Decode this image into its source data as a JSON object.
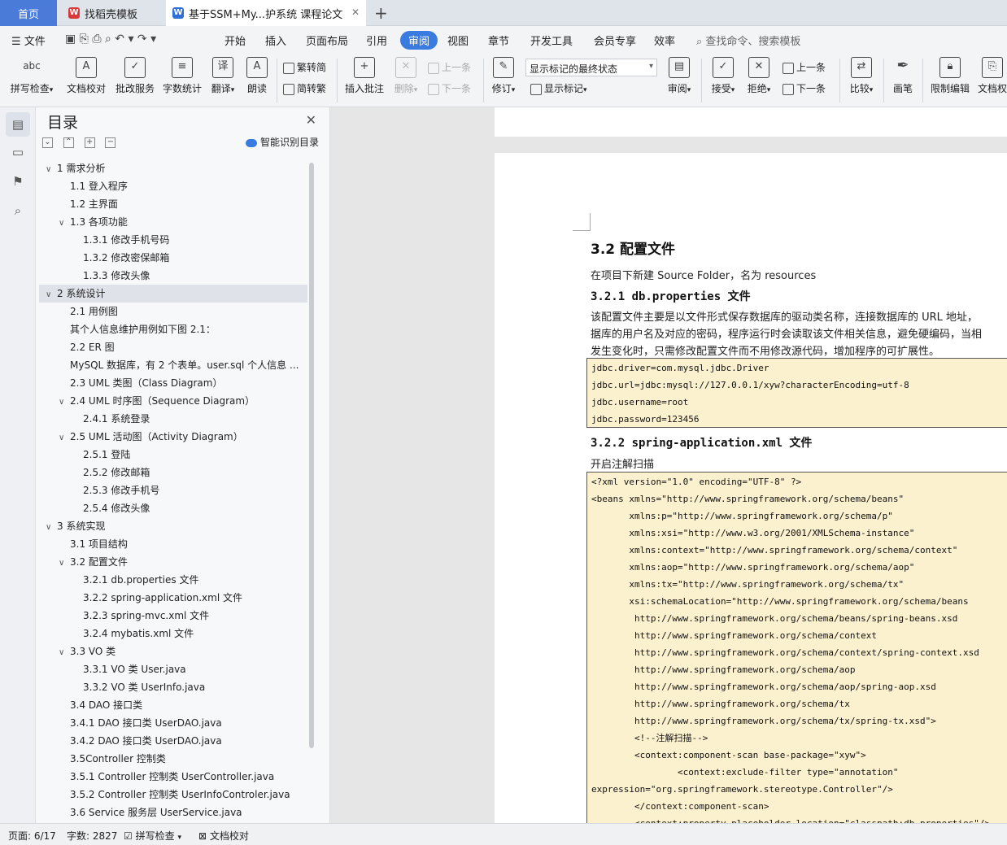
{
  "tabs": {
    "home": "首页",
    "pdf": "找稻壳模板",
    "doc": "基于SSM+My...护系统 课程论文"
  },
  "menu": {
    "file": "文件",
    "items": [
      "开始",
      "插入",
      "页面布局",
      "引用",
      "审阅",
      "视图",
      "章节",
      "开发工具",
      "会员专享",
      "效率"
    ],
    "active": "审阅",
    "search": "查找命令、搜索模板"
  },
  "ribbon": {
    "spellcheck": "拼写检查",
    "proofread": "文档校对",
    "correction": "批改服务",
    "wordcount": "字数统计",
    "translate": "翻译",
    "read": "朗读",
    "trad_to_simp": "繁转简",
    "simp_to_trad": "简转繁",
    "insert_comment": "插入批注",
    "delete": "删除",
    "prev": "上一条",
    "next": "下一条",
    "revise": "修订",
    "markup_dropdown": "显示标记的最终状态",
    "show_markup": "显示标记",
    "review": "审阅",
    "accept": "接受",
    "reject": "拒绝",
    "prev2": "上一条",
    "next2": "下一条",
    "compare": "比较",
    "pen": "画笔",
    "restrict": "限制编辑",
    "doc_rights": "文档权"
  },
  "toc": {
    "title": "目录",
    "smart": "智能识别目录",
    "items": [
      {
        "arrow": "∨",
        "text": "1  需求分析",
        "level": 0
      },
      {
        "arrow": "",
        "text": "1.1 登入程序",
        "level": 1
      },
      {
        "arrow": "",
        "text": "1.2 主界面",
        "level": 1
      },
      {
        "arrow": "∨",
        "text": "1.3 各项功能",
        "level": 1
      },
      {
        "arrow": "",
        "text": "1.3.1  修改手机号码",
        "level": 2
      },
      {
        "arrow": "",
        "text": "1.3.2  修改密保邮箱",
        "level": 2
      },
      {
        "arrow": "",
        "text": "1.3.3  修改头像",
        "level": 2
      },
      {
        "arrow": "∨",
        "text": "2  系统设计",
        "level": 0,
        "selected": true
      },
      {
        "arrow": "",
        "text": "2.1 用例图",
        "level": 1
      },
      {
        "arrow": "",
        "text": "其个人信息维护用例如下图 2.1：",
        "level": 1
      },
      {
        "arrow": "",
        "text": "2.2 ER 图",
        "level": 1
      },
      {
        "arrow": "",
        "text": "MySQL 数据库，有 2 个表单。user.sql 个人信息 ...",
        "level": 1
      },
      {
        "arrow": "",
        "text": "2.3 UML 类图（Class Diagram）",
        "level": 1
      },
      {
        "arrow": "∨",
        "text": "2.4 UML 时序图（Sequence Diagram）",
        "level": 1
      },
      {
        "arrow": "",
        "text": "2.4.1  系统登录",
        "level": 2
      },
      {
        "arrow": "∨",
        "text": "2.5 UML 活动图（Activity Diagram）",
        "level": 1
      },
      {
        "arrow": "",
        "text": "2.5.1  登陆",
        "level": 2
      },
      {
        "arrow": "",
        "text": "2.5.2  修改邮箱",
        "level": 2
      },
      {
        "arrow": "",
        "text": "2.5.3  修改手机号",
        "level": 2
      },
      {
        "arrow": "",
        "text": "2.5.4  修改头像",
        "level": 2
      },
      {
        "arrow": "∨",
        "text": "3  系统实现",
        "level": 0
      },
      {
        "arrow": "",
        "text": "3.1  项目结构",
        "level": 1
      },
      {
        "arrow": "∨",
        "text": "3.2  配置文件",
        "level": 1
      },
      {
        "arrow": "",
        "text": "3.2.1 db.properties 文件",
        "level": 2
      },
      {
        "arrow": "",
        "text": "3.2.2 spring-application.xml 文件",
        "level": 2
      },
      {
        "arrow": "",
        "text": "3.2.3 spring-mvc.xml 文件",
        "level": 2
      },
      {
        "arrow": "",
        "text": "3.2.4 mybatis.xml 文件",
        "level": 2
      },
      {
        "arrow": "∨",
        "text": "3.3 VO 类",
        "level": 1
      },
      {
        "arrow": "",
        "text": "3.3.1    VO 类 User.java",
        "level": 2
      },
      {
        "arrow": "",
        "text": "3.3.2    VO 类 UserInfo.java",
        "level": 2
      },
      {
        "arrow": "",
        "text": "3.4 DAO 接口类",
        "level": 1
      },
      {
        "arrow": "",
        "text": "3.4.1 DAO 接口类 UserDAO.java",
        "level": 1
      },
      {
        "arrow": "",
        "text": "3.4.2 DAO 接口类 UserDAO.java",
        "level": 1
      },
      {
        "arrow": "",
        "text": "3.5Controller 控制类",
        "level": 1
      },
      {
        "arrow": "",
        "text": "3.5.1 Controller 控制类 UserController.java",
        "level": 1
      },
      {
        "arrow": "",
        "text": "3.5.2 Controller 控制类 UserInfoControler.java",
        "level": 1
      },
      {
        "arrow": "",
        "text": "3.6 Service 服务层 UserService.java",
        "level": 1
      }
    ]
  },
  "doc": {
    "h2": "3.2 配置文件",
    "p1": "在项目下新建 Source Folder，名为 resources",
    "h3_1": "3.2.1 db.properties 文件",
    "p2": "该配置文件主要是以文件形式保存数据库的驱动类名称，连接数据库的 URL 地址，",
    "p3": "据库的用户名及对应的密码，程序运行时会读取该文件相关信息，避免硬编码，当相",
    "p4": "发生变化时，只需修改配置文件而不用修改源代码，增加程序的可扩展性。",
    "code1": [
      "jdbc.driver=com.mysql.jdbc.Driver",
      "jdbc.url=jdbc:mysql://127.0.0.1/xyw?characterEncoding=utf-8",
      "jdbc.username=root",
      "jdbc.password=123456"
    ],
    "h3_2": "3.2.2 spring-application.xml 文件",
    "p5": "开启注解扫描",
    "code2": [
      "<?xml version=\"1.0\" encoding=\"UTF-8\" ?>",
      "<beans xmlns=\"http://www.springframework.org/schema/beans\"",
      "       xmlns:p=\"http://www.springframework.org/schema/p\"",
      "       xmlns:xsi=\"http://www.w3.org/2001/XMLSchema-instance\"",
      "       xmlns:context=\"http://www.springframework.org/schema/context\"",
      "       xmlns:aop=\"http://www.springframework.org/schema/aop\"",
      "       xmlns:tx=\"http://www.springframework.org/schema/tx\"",
      "       xsi:schemaLocation=\"http://www.springframework.org/schema/beans",
      "        http://www.springframework.org/schema/beans/spring-beans.xsd",
      "        http://www.springframework.org/schema/context",
      "        http://www.springframework.org/schema/context/spring-context.xsd",
      "        http://www.springframework.org/schema/aop",
      "        http://www.springframework.org/schema/aop/spring-aop.xsd",
      "        http://www.springframework.org/schema/tx",
      "        http://www.springframework.org/schema/tx/spring-tx.xsd\">",
      "        <!--注解扫描-->",
      "        <context:component-scan base-package=\"xyw\">",
      "                <context:exclude-filter type=\"annotation\"",
      "expression=\"org.springframework.stereotype.Controller\"/>",
      "        </context:component-scan>",
      "        <context:property-placeholder location=\"classpath:db.properties\"/>"
    ]
  },
  "status": {
    "page": "页面: 6/17",
    "words": "字数: 2827",
    "spellcheck": "拼写检查",
    "proofread": "文档校对"
  }
}
